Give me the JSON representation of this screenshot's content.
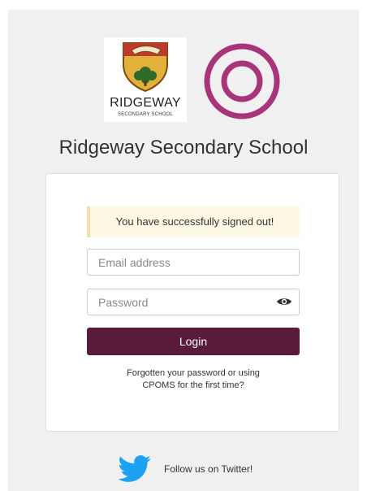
{
  "school": {
    "crest_name": "RIDGEWAY",
    "crest_subtitle": "SECONDARY SCHOOL",
    "title": "Ridgeway Secondary School"
  },
  "login_form": {
    "alert_message": "You have successfully signed out!",
    "email_placeholder": "Email address",
    "password_placeholder": "Password",
    "login_button": "Login",
    "forgot_line1": "Forgotten your password or using",
    "forgot_line2": "CPOMS for the first time?",
    "password_toggle_icon": "eye-icon"
  },
  "footer": {
    "twitter_label": "Follow us on Twitter!",
    "twitter_icon": "twitter-bird-icon"
  },
  "colors": {
    "brand_button": "#5a1a3a",
    "cpoms_ring": "#a8357a",
    "alert_background": "#fcf8e3",
    "twitter_blue": "#1da1f2",
    "crest_green": "#2f6b2a",
    "crest_gold": "#e2b13c",
    "crest_red": "#c0392b"
  }
}
